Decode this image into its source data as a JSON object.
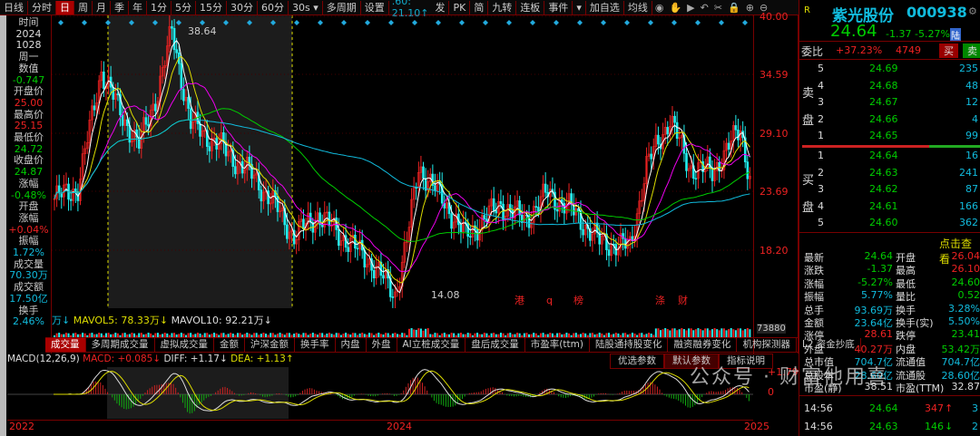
{
  "toolbar": {
    "items": [
      "日线",
      "分时",
      "日",
      "周",
      "月",
      "季",
      "年",
      "1分",
      "5分",
      "15分",
      "30分",
      "60分",
      "30s ▾",
      "多周期",
      "设置"
    ],
    "active_index": 2,
    "ma_readout": ".60: 21.10↑",
    "right_items": [
      "发",
      "PK",
      "简",
      "九转",
      "连板",
      "事件",
      "▾",
      "加自选",
      "均线"
    ],
    "tool_icons": [
      "eye-icon",
      "hand-icon",
      "play-icon",
      "undo-icon",
      "scissors-icon",
      "lock-icon",
      "zoom-in-icon",
      "zoom-out-icon"
    ]
  },
  "info": [
    [
      "时间",
      "lbl"
    ],
    [
      "2024",
      "w"
    ],
    [
      "1028",
      "w"
    ],
    [
      "周一",
      "lbl"
    ],
    [
      "数值",
      "lbl"
    ],
    [
      "-0.747",
      "g"
    ],
    [
      "开盘价",
      "lbl"
    ],
    [
      "25.00",
      "r"
    ],
    [
      "最高价",
      "lbl"
    ],
    [
      "25.15",
      "r"
    ],
    [
      "最低价",
      "lbl"
    ],
    [
      "24.72",
      "g"
    ],
    [
      "收盘价",
      "lbl"
    ],
    [
      "24.87",
      "g"
    ],
    [
      "涨幅",
      "lbl"
    ],
    [
      "-0.48%",
      "g"
    ],
    [
      "开盘",
      "lbl"
    ],
    [
      "涨幅",
      "lbl"
    ],
    [
      "+0.04%",
      "r"
    ],
    [
      "振幅",
      "lbl"
    ],
    [
      "1.72%",
      "c"
    ],
    [
      "成交量",
      "lbl"
    ],
    [
      "70.30万",
      "c"
    ],
    [
      "成交额",
      "lbl"
    ],
    [
      "17.50亿",
      "c"
    ],
    [
      "换手",
      "lbl"
    ],
    [
      "2.46%",
      "c"
    ]
  ],
  "chart": {
    "y_ticks": [
      "40.00",
      "34.59",
      "29.10",
      "23.69",
      "18.20"
    ],
    "y_values": [
      40.0,
      34.59,
      29.1,
      23.69,
      18.2
    ],
    "high_label": "38.64",
    "low_label": "14.08",
    "annotations": [
      "港",
      "q",
      "榜",
      "涤",
      "财"
    ],
    "price_path": [
      [
        0,
        23
      ],
      [
        10,
        24
      ],
      [
        20,
        35
      ],
      [
        28,
        31
      ],
      [
        36,
        28
      ],
      [
        44,
        33
      ],
      [
        50,
        38.6
      ],
      [
        58,
        30
      ],
      [
        70,
        28
      ],
      [
        85,
        25
      ],
      [
        95,
        22
      ],
      [
        102,
        19.5
      ],
      [
        112,
        21.5
      ],
      [
        125,
        19
      ],
      [
        135,
        17
      ],
      [
        145,
        14.08
      ],
      [
        150,
        19
      ],
      [
        155,
        26
      ],
      [
        165,
        23
      ],
      [
        175,
        19.5
      ],
      [
        190,
        22.5
      ],
      [
        200,
        21
      ],
      [
        210,
        23.5
      ],
      [
        220,
        22
      ],
      [
        232,
        19
      ],
      [
        245,
        18.5
      ],
      [
        252,
        26
      ],
      [
        262,
        30.5
      ],
      [
        270,
        26
      ],
      [
        280,
        25.5
      ],
      [
        292,
        29.5
      ],
      [
        296,
        25
      ]
    ],
    "colors": {
      "up": "#e22",
      "down": "#2ee",
      "ma5": "#fff",
      "ma10": "#dd0",
      "ma20": "#e0e",
      "ma60": "#0c0",
      "ma120": "#1bd"
    }
  },
  "volume": {
    "text_1": "万↓",
    "mavol5": "MAVOL5: 78.33万↓",
    "mavol10": "MAVOL10: 92.21万↓",
    "axis_label": "73880"
  },
  "tabs": [
    "成交量",
    "多周期成交量",
    "虚拟成交量",
    "金额",
    "沪深金额",
    "换手率",
    "内盘",
    "外盘",
    "AI立桩成交量",
    "盘后成交量",
    "市盈率(ttm)",
    "陆股通持股变化",
    "融资融券变化",
    "机构探测器",
    "L2 资金抄底"
  ],
  "macd": {
    "name": "MACD(12,26,9)",
    "macd": "MACD: +0.085↓",
    "diff": "DIFF: +1.17↓",
    "dea": "DEA: +1.13↑",
    "buttons": [
      "优选参数",
      "默认参数",
      "指标说明"
    ],
    "active_button": 1,
    "y_top": "+1.79",
    "y_zero": "0"
  },
  "dates": [
    "2022",
    "2024",
    "2025"
  ],
  "quote": {
    "badge": "R",
    "name": "紫光股份",
    "code": "000938",
    "price": "24.64",
    "change": "-1.37",
    "pct": "-5.27%",
    "market": "陆",
    "weibi_label": "委比",
    "weibi": "+37.23%",
    "weicha": "4749",
    "buy": "买",
    "sell": "卖",
    "asks": [
      [
        "5",
        "24.69",
        "235"
      ],
      [
        "4",
        "24.68",
        "48"
      ],
      [
        "3",
        "24.67",
        "12"
      ],
      [
        "2",
        "24.66",
        "4"
      ],
      [
        "1",
        "24.65",
        "99"
      ]
    ],
    "ask_label": [
      "卖",
      "盘"
    ],
    "bids": [
      [
        "1",
        "24.64",
        "16"
      ],
      [
        "2",
        "24.63",
        "241"
      ],
      [
        "3",
        "24.62",
        "87"
      ],
      [
        "4",
        "24.61",
        "166"
      ],
      [
        "5",
        "24.60",
        "362"
      ]
    ],
    "bid_label": [
      "买",
      "盘"
    ],
    "link": "点击查看",
    "stats": [
      [
        "最新",
        "24.64",
        "g",
        "开盘",
        "26.04",
        "r"
      ],
      [
        "涨跌",
        "-1.37",
        "g",
        "最高",
        "26.10",
        "r"
      ],
      [
        "涨幅",
        "-5.27%",
        "g",
        "最低",
        "24.60",
        "g"
      ],
      [
        "振幅",
        "5.77%",
        "c",
        "量比",
        "0.52",
        "g"
      ],
      [
        "总手",
        "93.69万",
        "c",
        "换手",
        "3.28%",
        "c"
      ],
      [
        "金额",
        "23.64亿",
        "c",
        "换手(实)",
        "5.50%",
        "c"
      ],
      [
        "涨停",
        "28.61",
        "r",
        "跌停",
        "23.41",
        "g"
      ],
      [
        "外盘",
        "40.27万",
        "r",
        "内盘",
        "53.42万",
        "g"
      ],
      [
        "总市值",
        "704.7亿",
        "c",
        "流通值",
        "704.7亿",
        "c"
      ],
      [
        "总股本",
        "28.60亿",
        "c",
        "流通股",
        "28.60亿",
        "c"
      ],
      [
        "市盈(静)",
        "38.51",
        "w",
        "市盈(TTM)",
        "32.87",
        "w"
      ]
    ],
    "ticks": [
      [
        "14:56",
        "24.64",
        "347",
        "↑",
        "r",
        "3"
      ],
      [
        "14:56",
        "24.63",
        "146",
        "↓",
        "g",
        "2"
      ]
    ]
  },
  "watermark": "公众号 · 财富他用喜"
}
